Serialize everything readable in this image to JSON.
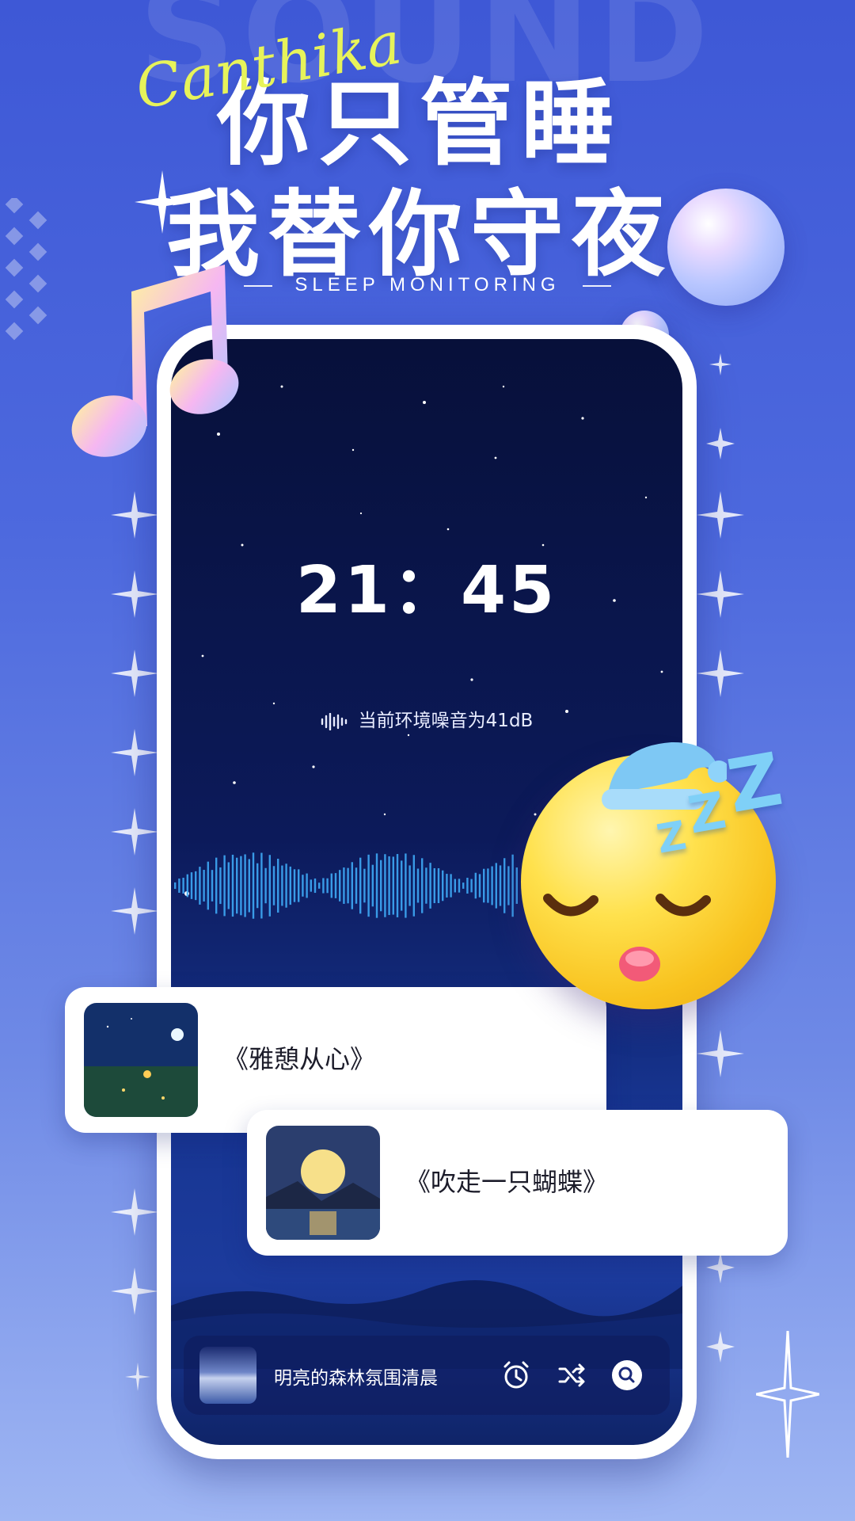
{
  "header": {
    "background_word": "SOUND",
    "script_logo": "Canthika",
    "title_line1": "你只管睡",
    "title_line2": "我替你守夜",
    "subtitle": "SLEEP MONITORING"
  },
  "monitor": {
    "time": "21：45",
    "noise_text": "当前环境噪音为41dB",
    "waveform_icon": "sound-wave-icon"
  },
  "cards": [
    {
      "title": "《雅憩从心》"
    },
    {
      "title": "《吹走一只蝴蝶》"
    }
  ],
  "player": {
    "track_name": "明亮的森林氛围清晨",
    "icons": [
      "alarm-clock-icon",
      "shuffle-icon",
      "search-icon"
    ]
  },
  "colors": {
    "background_top": "#3e58d6",
    "background_bottom": "#9fb6f3",
    "screen_dark": "#07103a",
    "wave_blue": "#3ea8f5",
    "script_yellow": "#e7f35a"
  }
}
